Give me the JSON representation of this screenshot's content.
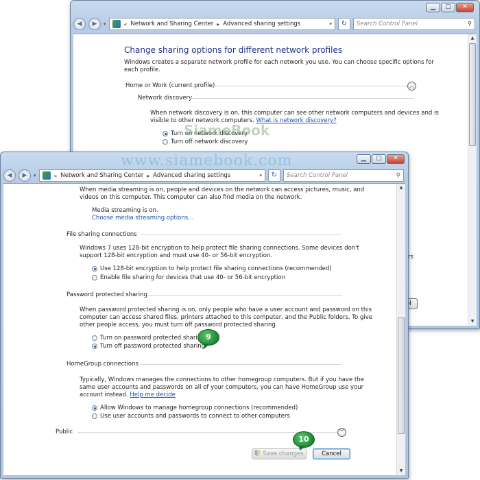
{
  "back_window": {
    "breadcrumb": [
      "Network and Sharing Center",
      "Advanced sharing settings"
    ],
    "search_placeholder": "Search Control Panel",
    "page_title": "Change sharing options for different network profiles",
    "intro": [
      "Windows creates a separate network profile for each network you use. You can choose specific options for",
      "each profile."
    ],
    "profile_label": "Home or Work (current profile)",
    "network_discovery_heading": "Network discovery",
    "nd_desc_line1": "When network discovery is on, this computer can see other network computers and devices and is",
    "nd_desc_line2": "visible to other network computers.",
    "nd_link": "What is network discovery?",
    "nd_options": [
      "Turn on network discovery",
      "Turn off network discovery"
    ],
    "partial_text": "rs",
    "partial_button": "el"
  },
  "watermark": {
    "text": "www.siamebook.com",
    "logo": "SiameBook"
  },
  "front_window": {
    "breadcrumb": [
      "Network and Sharing Center",
      "Advanced sharing settings"
    ],
    "search_placeholder": "Search Control Panel",
    "media": {
      "desc": [
        "When media streaming is on, people and devices on the network can access pictures, music, and",
        "videos on this computer. This computer can also find media on the network."
      ],
      "status": "Media streaming is on.",
      "link": "Choose media streaming options..."
    },
    "file_sharing": {
      "heading": "File sharing connections",
      "desc": [
        "Windows 7 uses 128-bit encryption to help protect file sharing connections. Some devices don't",
        "support 128-bit encryption and must use 40- or 56-bit encryption."
      ],
      "options": [
        "Use 128-bit encryption to help protect file sharing connections (recommended)",
        "Enable file sharing for devices that use 40- or 56-bit encryption"
      ]
    },
    "password": {
      "heading": "Password protected sharing",
      "desc": [
        "When password protected sharing is on, only people who have a user account and password on this",
        "computer can access shared files, printers attached to this computer, and the Public folders. To give",
        "other people access, you must turn off password protected sharing."
      ],
      "options": [
        "Turn on password protected sharing",
        "Turn off password protected sharing"
      ]
    },
    "homegroup": {
      "heading": "HomeGroup connections",
      "desc": [
        "Typically, Windows manages the connections to other homegroup computers. But if you have the",
        "same user accounts and passwords on all of your computers, you can have HomeGroup use your",
        "account instead."
      ],
      "link": "Help me decide",
      "options": [
        "Allow Windows to manage homegroup connections (recommended)",
        "Use user accounts and passwords to connect to other computers"
      ]
    },
    "public_label": "Public",
    "save_button": "Save changes",
    "cancel_button": "Cancel"
  },
  "step_badges": [
    "9",
    "10"
  ],
  "colors": {
    "title_blue": "#1e3287",
    "link_blue": "#1a4fa8",
    "badge_green": "#1d8a38",
    "frame_blue": "#b5cbe6"
  }
}
